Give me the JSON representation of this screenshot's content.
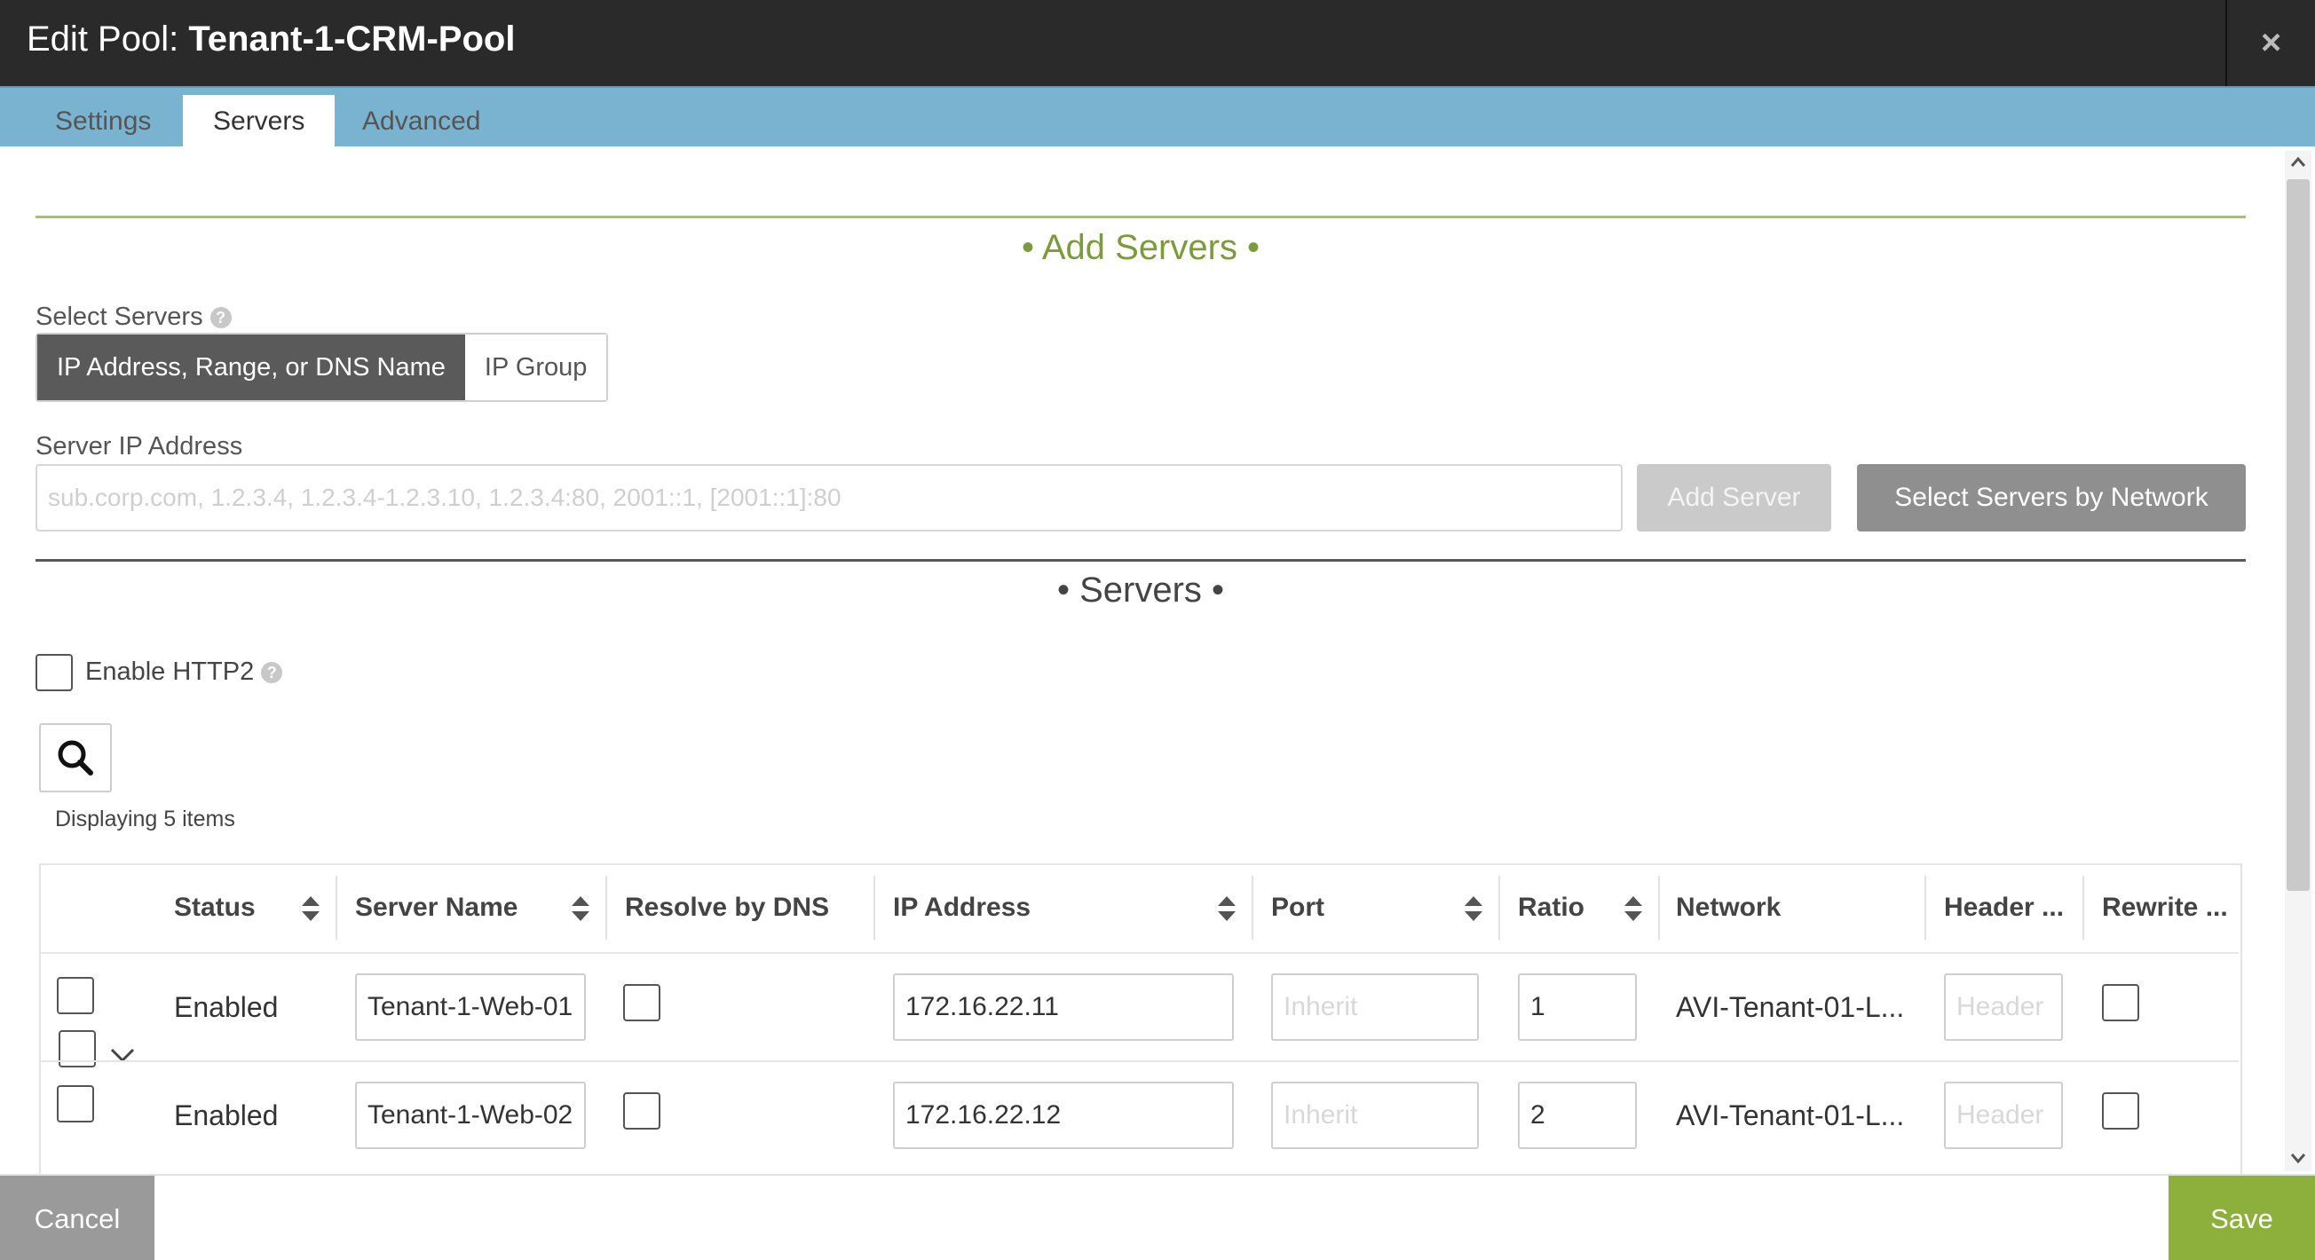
{
  "header": {
    "title_prefix": "Edit Pool: ",
    "pool_name": "Tenant-1-CRM-Pool",
    "close_glyph": "×"
  },
  "tabs": [
    {
      "label": "Settings",
      "active": false
    },
    {
      "label": "Servers",
      "active": true
    },
    {
      "label": "Advanced",
      "active": false
    }
  ],
  "add_servers": {
    "heading": "• Add Servers •",
    "select_servers_label": "Select Servers",
    "modes": [
      "IP Address, Range, or DNS Name",
      "IP Group"
    ],
    "server_ip_label": "Server IP Address",
    "server_ip_placeholder": "sub.corp.com, 1.2.3.4, 1.2.3.4-1.2.3.10, 1.2.3.4:80, 2001::1, [2001::1]:80",
    "server_ip_value": "",
    "add_server_label": "Add Server",
    "select_by_network_label": "Select Servers by Network"
  },
  "servers": {
    "heading": "• Servers •",
    "enable_http2_label": "Enable HTTP2",
    "displaying_text": "Displaying 5 items",
    "columns": [
      "Status",
      "Server Name",
      "Resolve by DNS",
      "IP Address",
      "Port",
      "Ratio",
      "Network",
      "Header ...",
      "Rewrite ..."
    ],
    "rows": [
      {
        "status": "Enabled",
        "server_name": "Tenant-1-Web-01",
        "ip_address": "172.16.22.11",
        "port_placeholder": "Inherit",
        "ratio": "1",
        "network": "AVI-Tenant-01-L...",
        "header_placeholder": "Header"
      },
      {
        "status": "Enabled",
        "server_name": "Tenant-1-Web-02",
        "ip_address": "172.16.22.12",
        "port_placeholder": "Inherit",
        "ratio": "2",
        "network": "AVI-Tenant-01-L...",
        "header_placeholder": "Header"
      }
    ]
  },
  "footer": {
    "cancel_label": "Cancel",
    "save_label": "Save"
  },
  "colors": {
    "header_bg": "#2a2a2b",
    "tabbar_bg": "#7ab3d0",
    "accent_green": "#8db03d",
    "section_green_text": "#7d9a3c"
  }
}
